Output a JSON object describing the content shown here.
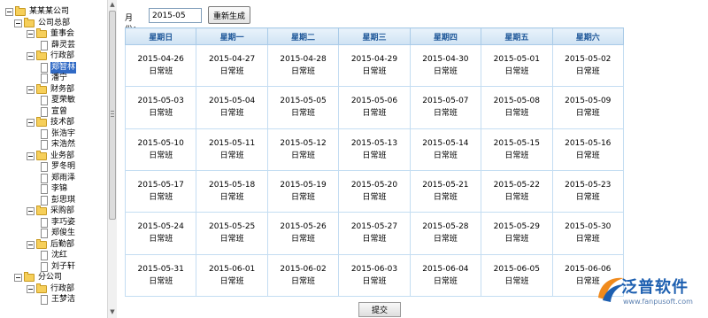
{
  "tree": [
    {
      "label": "某某某公司",
      "depth": 0,
      "kind": "folder",
      "expanded": true
    },
    {
      "label": "公司总部",
      "depth": 1,
      "kind": "folder",
      "expanded": true
    },
    {
      "label": "董事会",
      "depth": 2,
      "kind": "folder",
      "expanded": true
    },
    {
      "label": "薛灵芸",
      "depth": 3,
      "kind": "person"
    },
    {
      "label": "行政部",
      "depth": 2,
      "kind": "folder",
      "expanded": true
    },
    {
      "label": "郑智林",
      "depth": 3,
      "kind": "person",
      "selected": true
    },
    {
      "label": "潘宁",
      "depth": 3,
      "kind": "person"
    },
    {
      "label": "财务部",
      "depth": 2,
      "kind": "folder",
      "expanded": true
    },
    {
      "label": "夏荣敏",
      "depth": 3,
      "kind": "person"
    },
    {
      "label": "宣曾",
      "depth": 3,
      "kind": "person"
    },
    {
      "label": "技术部",
      "depth": 2,
      "kind": "folder",
      "expanded": true
    },
    {
      "label": "张浩宇",
      "depth": 3,
      "kind": "person"
    },
    {
      "label": "宋浩然",
      "depth": 3,
      "kind": "person"
    },
    {
      "label": "业务部",
      "depth": 2,
      "kind": "folder",
      "expanded": true
    },
    {
      "label": "罗冬明",
      "depth": 3,
      "kind": "person"
    },
    {
      "label": "郑雨泽",
      "depth": 3,
      "kind": "person"
    },
    {
      "label": "李锦",
      "depth": 3,
      "kind": "person"
    },
    {
      "label": "彭思琪",
      "depth": 3,
      "kind": "person"
    },
    {
      "label": "采购部",
      "depth": 2,
      "kind": "folder",
      "expanded": true
    },
    {
      "label": "李巧姿",
      "depth": 3,
      "kind": "person"
    },
    {
      "label": "郑俊生",
      "depth": 3,
      "kind": "person"
    },
    {
      "label": "后勤部",
      "depth": 2,
      "kind": "folder",
      "expanded": true
    },
    {
      "label": "沈红",
      "depth": 3,
      "kind": "person"
    },
    {
      "label": "刘子轩",
      "depth": 3,
      "kind": "person"
    },
    {
      "label": "分公司",
      "depth": 1,
      "kind": "folder",
      "expanded": true
    },
    {
      "label": "行政部",
      "depth": 2,
      "kind": "folder",
      "expanded": true
    },
    {
      "label": "王梦洁",
      "depth": 3,
      "kind": "person"
    }
  ],
  "toolbar": {
    "month_label": "月份：",
    "month_value": "2015-05",
    "regenerate_label": "重新生成"
  },
  "calendar": {
    "headers": [
      "星期日",
      "星期一",
      "星期二",
      "星期三",
      "星期四",
      "星期五",
      "星期六"
    ],
    "shift": "日常班",
    "weeks": [
      [
        "2015-04-26",
        "2015-04-27",
        "2015-04-28",
        "2015-04-29",
        "2015-04-30",
        "2015-05-01",
        "2015-05-02"
      ],
      [
        "2015-05-03",
        "2015-05-04",
        "2015-05-05",
        "2015-05-06",
        "2015-05-07",
        "2015-05-08",
        "2015-05-09"
      ],
      [
        "2015-05-10",
        "2015-05-11",
        "2015-05-12",
        "2015-05-13",
        "2015-05-14",
        "2015-05-15",
        "2015-05-16"
      ],
      [
        "2015-05-17",
        "2015-05-18",
        "2015-05-19",
        "2015-05-20",
        "2015-05-21",
        "2015-05-22",
        "2015-05-23"
      ],
      [
        "2015-05-24",
        "2015-05-25",
        "2015-05-26",
        "2015-05-27",
        "2015-05-28",
        "2015-05-29",
        "2015-05-30"
      ],
      [
        "2015-05-31",
        "2015-06-01",
        "2015-06-02",
        "2015-06-03",
        "2015-06-04",
        "2015-06-05",
        "2015-06-06"
      ]
    ]
  },
  "submit_label": "提交",
  "watermark": {
    "brand": "泛普软件",
    "url": "www.fanpusoft.com"
  }
}
